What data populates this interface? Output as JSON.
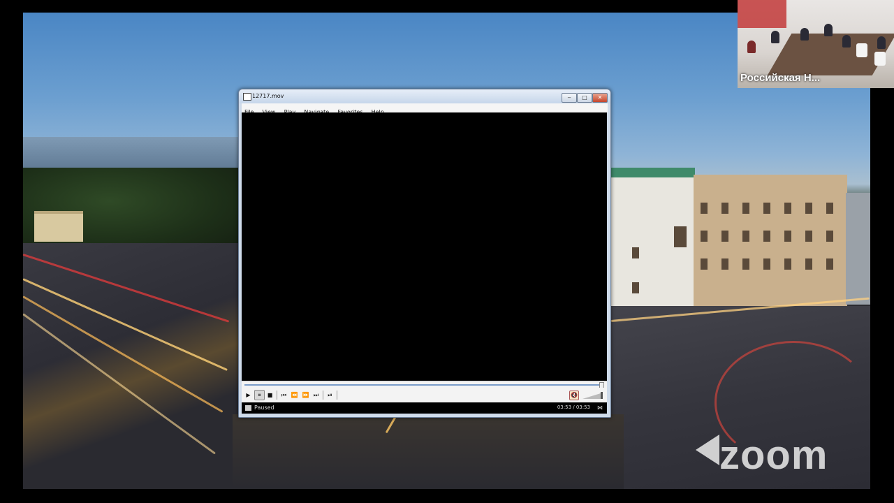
{
  "desktop": {
    "description_icon": "city-background"
  },
  "thumbnail": {
    "participant_name": "Российская Н..."
  },
  "watermark": {
    "text": "zoom"
  },
  "player": {
    "title": "12717.mov",
    "window_buttons": {
      "minimize": "‒",
      "maximize": "□",
      "close": "✕"
    },
    "menu": [
      "File",
      "View",
      "Play",
      "Navigate",
      "Favorites",
      "Help"
    ],
    "controls": {
      "play": "▶",
      "pause": "⏸",
      "stop": "■",
      "prev": "⏮",
      "rewind": "⏪",
      "forward": "⏩",
      "next": "⏭",
      "frame_step": "⏯",
      "mute": "🔇"
    },
    "status": "Paused",
    "time": "03:53 / 03:53",
    "progress": 1.0,
    "volume": 1.0
  }
}
